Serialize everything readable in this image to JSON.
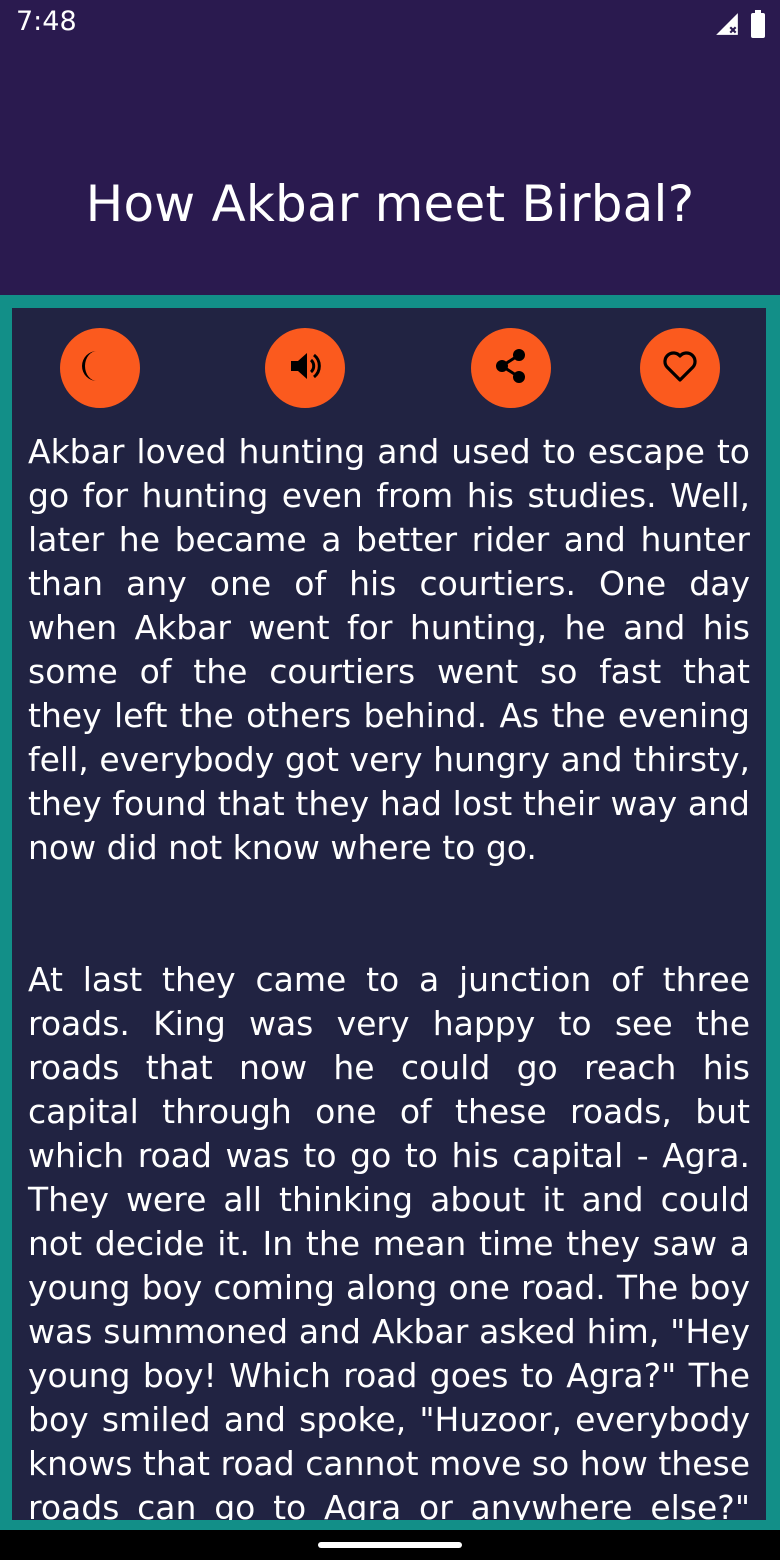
{
  "status_bar": {
    "time": "7:48",
    "icons": [
      "signal-icon",
      "battery-icon"
    ]
  },
  "header": {
    "title": "How Akbar meet Birbal?",
    "background": "#2a1a4f"
  },
  "actions": [
    {
      "icon": "moon-icon",
      "name": "night-mode-button"
    },
    {
      "icon": "speaker-icon",
      "name": "speak-button"
    },
    {
      "icon": "share-icon",
      "name": "share-button"
    },
    {
      "icon": "heart-icon",
      "name": "favorite-button"
    }
  ],
  "colors": {
    "accent": "#fb5a1e",
    "frame": "#128f88",
    "content_bg": "#212342"
  },
  "story": {
    "paragraphs": [
      "Akbar loved hunting and used to escape to go for hunting even from his studies. Well, later he became a better rider and hunter than any one of his courtiers. One day when Akbar went for hunting, he and his some of the courtiers went so fast that they left the others behind. As the evening fell, everybody got very hungry and thirsty, they found that they had lost their way and now did not know where to go.",
      "At last they came to a junction of three roads. King was very happy to see the roads that now he could go reach his capital through one of these roads, but which road was to go to his capital - Agra. They were all thinking about it and could not decide it. In the mean time they saw a young boy coming along one road. The boy was summoned and Akbar asked him, \"Hey young boy! Which road goes to Agra?\" The boy smiled and spoke, \"Huzoor, everybody knows that road cannot move so how these roads can go to Agra or anywhere else?\" and laughed"
    ]
  }
}
